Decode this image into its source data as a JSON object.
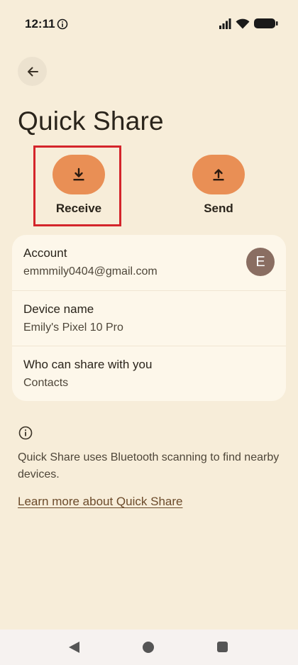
{
  "status_bar": {
    "time": "12:11",
    "icons": [
      "info-icon",
      "signal-icon",
      "wifi-icon",
      "battery-icon"
    ]
  },
  "header": {
    "back_icon": "arrow-back-icon",
    "title": "Quick Share"
  },
  "actions": {
    "receive": {
      "label": "Receive",
      "icon": "download-icon"
    },
    "send": {
      "label": "Send",
      "icon": "upload-icon"
    }
  },
  "settings": {
    "account": {
      "title": "Account",
      "value": "emmmily0404@gmail.com",
      "avatar_letter": "E"
    },
    "device": {
      "title": "Device name",
      "value": "Emily's Pixel 10 Pro"
    },
    "visibility": {
      "title": "Who can share with you",
      "value": "Contacts"
    }
  },
  "info": {
    "text": "Quick Share uses Bluetooth scanning to find nearby devices.",
    "link": "Learn more about Quick Share"
  },
  "colors": {
    "background": "#f7edd9",
    "card": "#fdf7ea",
    "accent": "#e98f55",
    "highlight": "#d4252b",
    "avatar": "#8a6e62"
  },
  "nav": {
    "icons": [
      "nav-back-icon",
      "nav-home-icon",
      "nav-recents-icon"
    ]
  }
}
